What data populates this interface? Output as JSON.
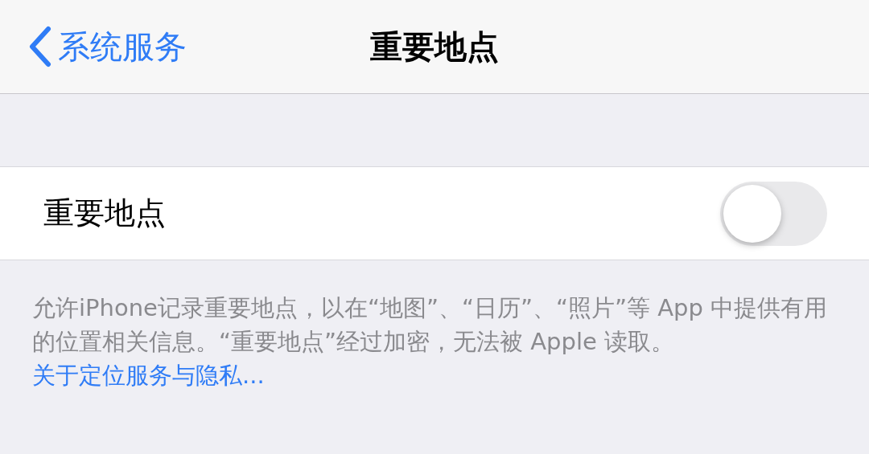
{
  "nav": {
    "back": "系统服务",
    "title": "重要地点"
  },
  "setting": {
    "label": "重要地点",
    "on": false
  },
  "footer": {
    "text": "允许iPhone记录重要地点，以在“地图”、“日历”、“照片”等 App 中提供有用的位置相关信息。“重要地点”经过加密，无法被 Apple 读取。",
    "link": "关于定位服务与隐私..."
  }
}
